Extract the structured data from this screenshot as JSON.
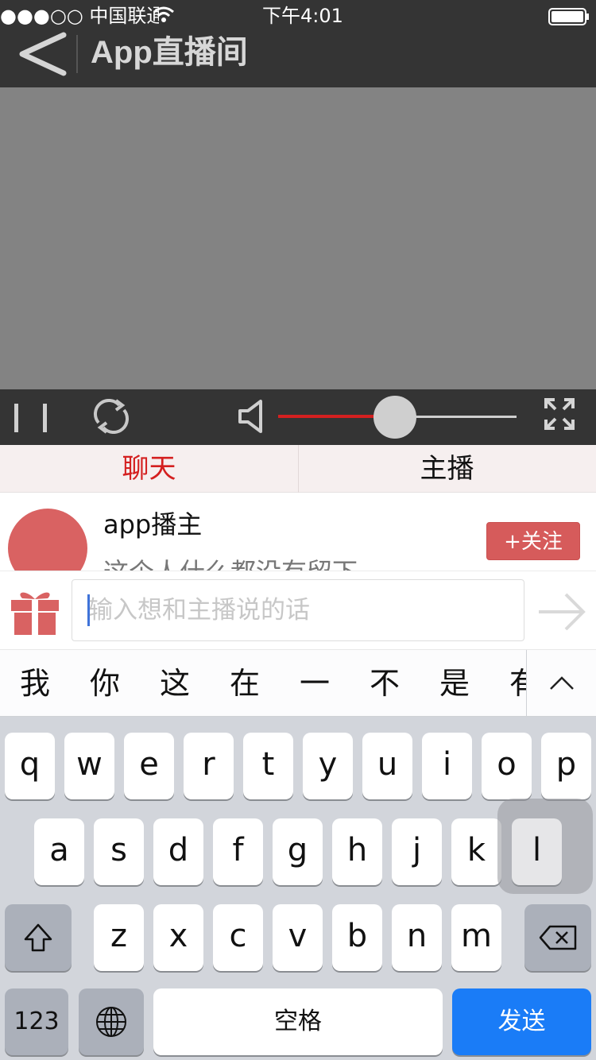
{
  "status_bar": {
    "carrier": "●●●○○ 中国联通",
    "time": "下午4:01"
  },
  "nav": {
    "title": "App直播间",
    "icons": [
      "back-arrow-icon"
    ]
  },
  "player": {
    "volume_level": 0.49,
    "icons": [
      "pause-icon",
      "refresh-icon",
      "volume-icon",
      "fullscreen-icon"
    ]
  },
  "tabs": [
    {
      "label": "聊天",
      "active": true
    },
    {
      "label": "主播",
      "active": false
    }
  ],
  "host": {
    "name": "app播主",
    "description": "这个人什么都没有留下",
    "follow_label": "+关注"
  },
  "chat_input": {
    "placeholder": "输入想和主播说的话",
    "icons": [
      "gift-icon",
      "send-arrow-icon"
    ]
  },
  "candidates": [
    "我",
    "你",
    "这",
    "在",
    "一",
    "不",
    "是",
    "有"
  ],
  "keyboard": {
    "row1": [
      "q",
      "w",
      "e",
      "r",
      "t",
      "y",
      "u",
      "i",
      "o",
      "p"
    ],
    "row2": [
      "a",
      "s",
      "d",
      "f",
      "g",
      "h",
      "j",
      "k",
      "l"
    ],
    "row3": [
      "z",
      "x",
      "c",
      "v",
      "b",
      "n",
      "m"
    ],
    "numbers_label": "123",
    "space_label": "空格",
    "send_label": "发送",
    "icons": [
      "shift-icon",
      "backspace-icon",
      "globe-icon",
      "chevron-up-icon"
    ]
  },
  "colors": {
    "accent_red": "#d42020",
    "follow_red": "#d65b5b",
    "send_blue": "#1a7cf7",
    "nav_bg": "#343434"
  }
}
